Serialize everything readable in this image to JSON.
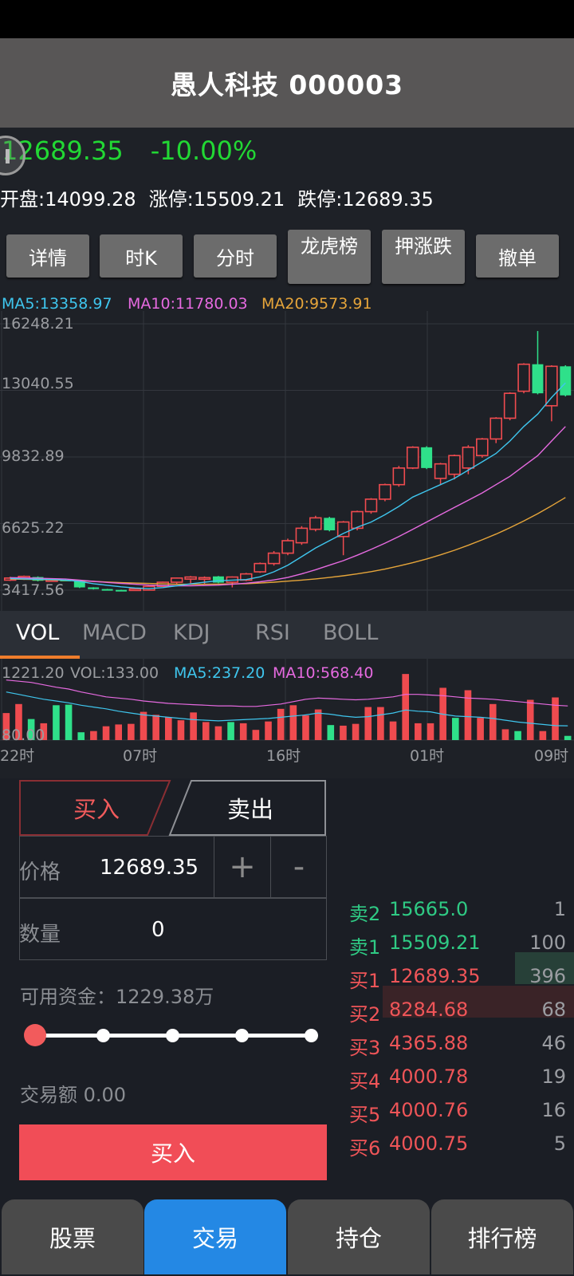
{
  "header": {
    "title": "愚人科技 000003"
  },
  "quote": {
    "price": "12689.35",
    "change_pct": "-10.00%",
    "open_label": "开盘:",
    "open_value": "14099.28",
    "limit_up_label": "涨停:",
    "limit_up_value": "15509.21",
    "limit_down_label": "跌停:",
    "limit_down_value": "12689.35"
  },
  "actions": [
    "详情",
    "时K",
    "分时",
    "龙虎榜",
    "押涨跌",
    "撤单"
  ],
  "ma_legend": {
    "ma5": "MA5:13358.97",
    "ma10": "MA10:11780.03",
    "ma20": "MA20:9573.91"
  },
  "colors": {
    "up": "#ef4b4f",
    "down": "#2fe08a",
    "ma5": "#3fc6ee",
    "ma10": "#e66ae0",
    "ma20": "#e6a53a",
    "accent": "#2488e4",
    "buy": "#f14d57"
  },
  "chart_data": [
    {
      "type": "candlestick",
      "y_tick_labels": [
        "16248.21",
        "13040.55",
        "9832.89",
        "6625.22",
        "3417.56"
      ],
      "ylim": [
        3417.56,
        16248.21
      ],
      "grid": true,
      "candles": [
        {
          "o": 3900,
          "c": 4000,
          "h": 4060,
          "l": 3860
        },
        {
          "o": 3950,
          "c": 4080,
          "h": 4120,
          "l": 3910
        },
        {
          "o": 4050,
          "c": 3870,
          "h": 4080,
          "l": 3840
        },
        {
          "o": 3880,
          "c": 3920,
          "h": 3950,
          "l": 3860
        },
        {
          "o": 3920,
          "c": 3880,
          "h": 3940,
          "l": 3860
        },
        {
          "o": 3860,
          "c": 3550,
          "h": 3880,
          "l": 3520
        },
        {
          "o": 3550,
          "c": 3470,
          "h": 3560,
          "l": 3450
        },
        {
          "o": 3470,
          "c": 3430,
          "h": 3480,
          "l": 3420
        },
        {
          "o": 3430,
          "c": 3420,
          "h": 3440,
          "l": 3410
        },
        {
          "o": 3440,
          "c": 3480,
          "h": 3500,
          "l": 3420
        },
        {
          "o": 3420,
          "c": 3600,
          "h": 3620,
          "l": 3400
        },
        {
          "o": 3600,
          "c": 3800,
          "h": 3830,
          "l": 3580
        },
        {
          "o": 3800,
          "c": 4000,
          "h": 4030,
          "l": 3700
        },
        {
          "o": 3950,
          "c": 4050,
          "h": 4100,
          "l": 3750
        },
        {
          "o": 4000,
          "c": 4020,
          "h": 4080,
          "l": 3700
        },
        {
          "o": 4080,
          "c": 3780,
          "h": 4100,
          "l": 3750
        },
        {
          "o": 3800,
          "c": 4050,
          "h": 4080,
          "l": 3550
        },
        {
          "o": 3900,
          "c": 4200,
          "h": 4250,
          "l": 3850
        },
        {
          "o": 4300,
          "c": 4700,
          "h": 4750,
          "l": 4250
        },
        {
          "o": 4700,
          "c": 5200,
          "h": 5300,
          "l": 4600
        },
        {
          "o": 5200,
          "c": 5800,
          "h": 5900,
          "l": 5100
        },
        {
          "o": 5700,
          "c": 6400,
          "h": 6500,
          "l": 5600
        },
        {
          "o": 6350,
          "c": 6900,
          "h": 7000,
          "l": 6250
        },
        {
          "o": 6900,
          "c": 6300,
          "h": 6950,
          "l": 6250
        },
        {
          "o": 6000,
          "c": 6700,
          "h": 6750,
          "l": 5100
        },
        {
          "o": 6400,
          "c": 7200,
          "h": 7250,
          "l": 6300
        },
        {
          "o": 7200,
          "c": 7800,
          "h": 7850,
          "l": 7100
        },
        {
          "o": 7800,
          "c": 8500,
          "h": 8550,
          "l": 7700
        },
        {
          "o": 8500,
          "c": 9300,
          "h": 9400,
          "l": 8400
        },
        {
          "o": 9300,
          "c": 10300,
          "h": 10350,
          "l": 9250
        },
        {
          "o": 10300,
          "c": 9300,
          "h": 10350,
          "l": 9250
        },
        {
          "o": 8800,
          "c": 9500,
          "h": 9550,
          "l": 8500
        },
        {
          "o": 9000,
          "c": 9900,
          "h": 9950,
          "l": 8750
        },
        {
          "o": 9300,
          "c": 10300,
          "h": 10400,
          "l": 9000
        },
        {
          "o": 9900,
          "c": 10700,
          "h": 10750,
          "l": 9800
        },
        {
          "o": 10700,
          "c": 11700,
          "h": 11750,
          "l": 10500
        },
        {
          "o": 11700,
          "c": 12900,
          "h": 12950,
          "l": 11600
        },
        {
          "o": 13000,
          "c": 14300,
          "h": 14350,
          "l": 12900
        },
        {
          "o": 14300,
          "c": 12900,
          "h": 15900,
          "l": 12850
        },
        {
          "o": 12300,
          "c": 14200,
          "h": 14250,
          "l": 11550
        },
        {
          "o": 14200,
          "c": 12800,
          "h": 14250,
          "l": 12750
        }
      ],
      "ma5": [
        3980,
        3960,
        3940,
        3930,
        3900,
        3840,
        3730,
        3650,
        3580,
        3520,
        3490,
        3540,
        3630,
        3720,
        3800,
        3870,
        3900,
        3930,
        4060,
        4300,
        4620,
        5030,
        5450,
        5800,
        6150,
        6450,
        6700,
        7050,
        7450,
        7900,
        8200,
        8500,
        8800,
        9200,
        9600,
        10000,
        10600,
        11300,
        11900,
        12700,
        13400
      ],
      "ma10": [
        4020,
        4010,
        3990,
        3970,
        3950,
        3900,
        3840,
        3790,
        3740,
        3700,
        3660,
        3640,
        3630,
        3630,
        3640,
        3660,
        3700,
        3750,
        3820,
        3910,
        4030,
        4200,
        4400,
        4620,
        4840,
        5100,
        5380,
        5680,
        6000,
        6350,
        6700,
        7050,
        7400,
        7750,
        8100,
        8500,
        8900,
        9400,
        9900,
        10600,
        11300
      ],
      "ma20": [
        3950,
        3940,
        3930,
        3910,
        3890,
        3870,
        3840,
        3810,
        3780,
        3760,
        3740,
        3720,
        3700,
        3700,
        3700,
        3710,
        3720,
        3730,
        3760,
        3800,
        3850,
        3900,
        3960,
        4030,
        4110,
        4200,
        4310,
        4430,
        4580,
        4740,
        4920,
        5120,
        5340,
        5580,
        5840,
        6120,
        6420,
        6750,
        7100,
        7480,
        7880
      ]
    },
    {
      "type": "bar",
      "legend": {
        "top": "1221.20",
        "vol": "VOL:133.00",
        "ma5": "MA5:237.20",
        "ma10": "MA10:568.40"
      },
      "y_bottom_label": "80.00",
      "ylim": [
        0,
        1221.2
      ],
      "x_tick_labels": [
        "22时",
        "07时",
        "16时",
        "01时",
        "09时"
      ],
      "volumes": [
        450,
        600,
        350,
        280,
        580,
        590,
        130,
        150,
        230,
        260,
        270,
        470,
        420,
        380,
        330,
        460,
        300,
        230,
        300,
        280,
        170,
        310,
        520,
        580,
        410,
        510,
        250,
        240,
        270,
        550,
        550,
        310,
        1100,
        280,
        280,
        870,
        370,
        830,
        370,
        600,
        180,
        150,
        670,
        150,
        710,
        70
      ],
      "up": [
        true,
        true,
        false,
        true,
        false,
        false,
        false,
        true,
        true,
        true,
        true,
        true,
        true,
        true,
        true,
        true,
        true,
        true,
        false,
        true,
        true,
        true,
        true,
        true,
        true,
        true,
        false,
        true,
        true,
        true,
        true,
        true,
        true,
        true,
        true,
        true,
        false,
        true,
        true,
        true,
        true,
        false,
        true,
        true,
        true,
        false
      ],
      "ma5": [
        800,
        760,
        720,
        680,
        650,
        620,
        580,
        550,
        520,
        480,
        450,
        420,
        400,
        380,
        360,
        340,
        330,
        320,
        330,
        340,
        350,
        360,
        380,
        400,
        420,
        450,
        430,
        400,
        380,
        390,
        420,
        450,
        500,
        480,
        470,
        430,
        400,
        390,
        380,
        360,
        330,
        300,
        280,
        260,
        240,
        237
      ],
      "ma10": [
        1000,
        980,
        960,
        920,
        880,
        850,
        800,
        760,
        720,
        700,
        680,
        650,
        630,
        610,
        600,
        590,
        580,
        570,
        570,
        560,
        560,
        580,
        600,
        640,
        680,
        700,
        690,
        680,
        670,
        680,
        700,
        720,
        760,
        760,
        750,
        740,
        720,
        700,
        690,
        680,
        660,
        640,
        620,
        600,
        580,
        568
      ]
    }
  ],
  "indicator_tabs": [
    "VOL",
    "MACD",
    "KDJ",
    "RSI",
    "BOLL"
  ],
  "trade": {
    "buy_tab": "买入",
    "sell_tab": "卖出",
    "price_label": "价格",
    "price_value": "12689.35",
    "plus": "+",
    "minus": "-",
    "qty_label": "数量",
    "qty_value": "0",
    "available": "可用资金：1229.38万",
    "amount": "交易额 0.00",
    "slider_position": 0,
    "submit": "买入"
  },
  "order_book": [
    {
      "side": "sell",
      "level": "卖2",
      "price": "15665.0",
      "qty": "1"
    },
    {
      "side": "sell",
      "level": "卖1",
      "price": "15509.21",
      "qty": "100"
    },
    {
      "side": "buy",
      "level": "买1",
      "price": "12689.35",
      "qty": "396"
    },
    {
      "side": "buy",
      "level": "买2",
      "price": "8284.68",
      "qty": "68"
    },
    {
      "side": "buy",
      "level": "买3",
      "price": "4365.88",
      "qty": "46"
    },
    {
      "side": "buy",
      "level": "买4",
      "price": "4000.78",
      "qty": "19"
    },
    {
      "side": "buy",
      "level": "买5",
      "price": "4000.76",
      "qty": "16"
    },
    {
      "side": "buy",
      "level": "买6",
      "price": "4000.75",
      "qty": "5"
    }
  ],
  "nav": [
    "股票",
    "交易",
    "持仓",
    "排行榜"
  ],
  "nav_active": "交易"
}
